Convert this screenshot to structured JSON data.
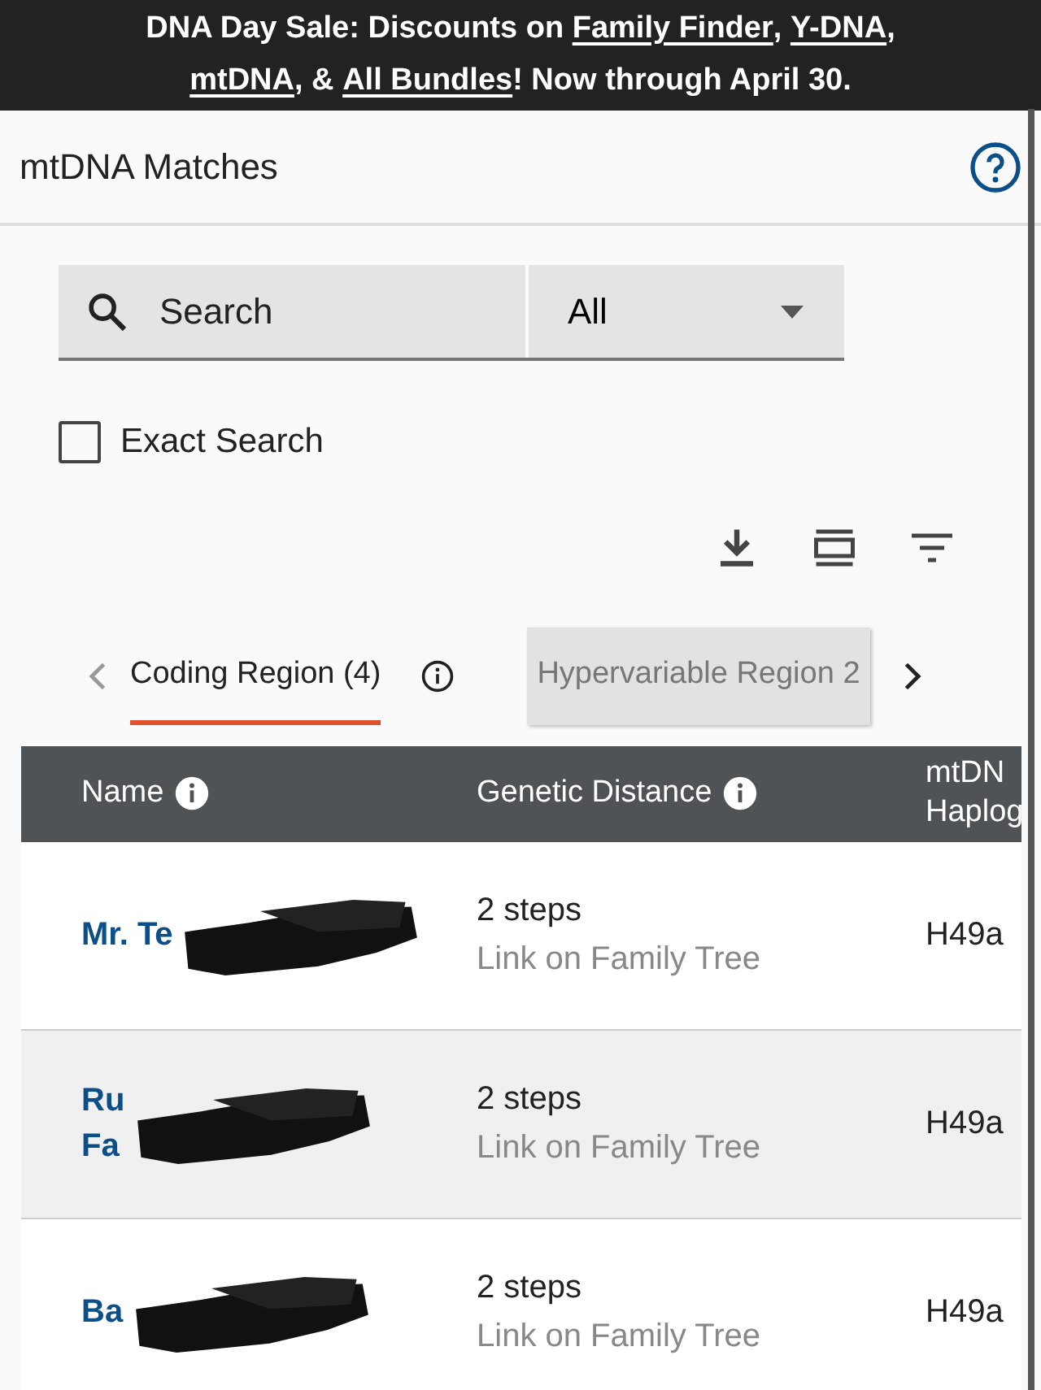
{
  "banner": {
    "lines": [
      [
        {
          "text": "DNA Day Sale: Discounts on ",
          "link": false
        },
        {
          "text": "Family Finder",
          "link": true
        },
        {
          "text": ", ",
          "link": false
        },
        {
          "text": "Y-DNA",
          "link": true
        },
        {
          "text": ",",
          "link": false
        }
      ],
      [
        {
          "text": "mtDNA",
          "link": true
        },
        {
          "text": ", & ",
          "link": false
        },
        {
          "text": "All Bundles",
          "link": true
        },
        {
          "text": "! Now through April 30.",
          "link": false
        }
      ]
    ]
  },
  "header": {
    "title": "mtDNA Matches"
  },
  "search": {
    "placeholder": "Search",
    "filter_value": "All"
  },
  "exact_search": {
    "label": "Exact Search",
    "checked": false
  },
  "tabs": [
    {
      "label": "Coding Region (4)",
      "selected": true,
      "info": true
    },
    {
      "label": "Hypervariable Region 2",
      "selected": false,
      "info": false
    }
  ],
  "table": {
    "columns": [
      {
        "lines": [
          "Name"
        ],
        "info": true
      },
      {
        "lines": [
          "Genetic Distance"
        ],
        "info": true
      },
      {
        "lines": [
          "mtDN",
          "Haplog"
        ],
        "info": false
      }
    ],
    "rows": [
      {
        "name": [
          "Mr. Te"
        ],
        "distance": "2 steps",
        "tree_link": "Link on Family Tree",
        "haplogroup": "H49a",
        "highlighted": false,
        "redacted": true
      },
      {
        "name": [
          "Ru",
          "Fa"
        ],
        "distance": "2 steps",
        "tree_link": "Link on Family Tree",
        "haplogroup": "H49a",
        "highlighted": true,
        "redacted": true
      },
      {
        "name": [
          "Ba"
        ],
        "distance": "2 steps",
        "tree_link": "Link on Family Tree",
        "haplogroup": "H49a",
        "highlighted": false,
        "redacted": true
      }
    ]
  }
}
